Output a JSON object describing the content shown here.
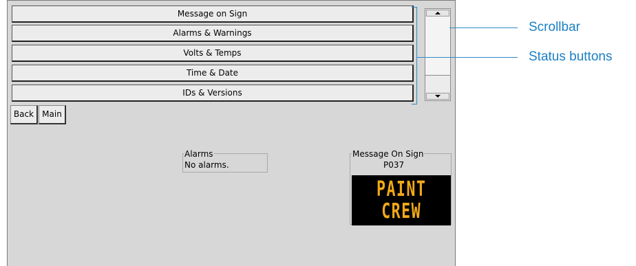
{
  "status_buttons": [
    {
      "label": "Message on Sign"
    },
    {
      "label": "Alarms & Warnings"
    },
    {
      "label": "Volts & Temps"
    },
    {
      "label": "Time & Date"
    },
    {
      "label": "IDs & Versions"
    }
  ],
  "nav": {
    "back_label": "Back",
    "main_label": "Main"
  },
  "alarms": {
    "title": "Alarms",
    "text": "No alarms."
  },
  "message_on_sign": {
    "title": "Message On Sign",
    "code": "P037",
    "lines": [
      "PAINT",
      "CREW"
    ],
    "led_color": "#f2a918"
  },
  "callouts": {
    "scrollbar": "Scrollbar",
    "status_buttons": "Status buttons"
  },
  "colors": {
    "accent": "#1a7fc3",
    "panel_bg": "#d7d7d7",
    "led_background": "#000000"
  }
}
